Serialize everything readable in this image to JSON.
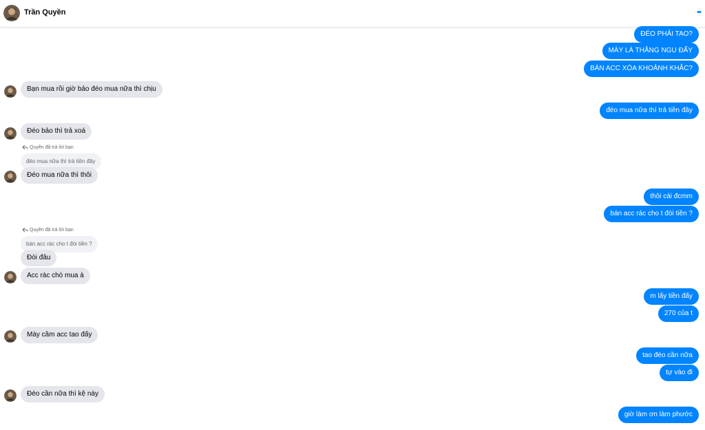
{
  "header": {
    "name": "Trần Quyền",
    "more_icon": "more-dots-icon"
  },
  "colors": {
    "outgoing_bubble": "#0084ff",
    "incoming_bubble": "#e4e6eb",
    "quote_bubble": "#f0f2f5",
    "secondary_text": "#65676b"
  },
  "messages": [
    {
      "from": "me",
      "text": "ĐÉO PHẢI TAO?"
    },
    {
      "from": "me",
      "text": "MÀY LÀ THẰNG NGU ĐẤY"
    },
    {
      "from": "me",
      "text": "BÁN ACC XÓA KHOẢNH KHẮC?"
    },
    {
      "from": "them",
      "text": "Bạn mua rồi giờ bảo đéo mua nữa thì chịu"
    },
    {
      "from": "me",
      "text": "đéo mua nữa thì trả tiền đây"
    },
    {
      "from": "them",
      "text": "Đéo bảo thì trả xoá"
    },
    {
      "from": "them",
      "reply_label": "Quyền đã trả lời bạn",
      "quoted": "đéo mua nữa thì trả tiền đây",
      "text": "Đéo mua nữa thì thôi"
    },
    {
      "from": "me",
      "text": "thôi cái đcmm"
    },
    {
      "from": "me",
      "text": "bán acc rác cho t đòi tiền ?"
    },
    {
      "from": "them",
      "reply_label": "Quyền đã trả lời bạn",
      "quoted": "bán acc rác cho t đòi tiền ?",
      "text": "Đòi đâu"
    },
    {
      "from": "them",
      "text": "Acc rác chó mua à"
    },
    {
      "from": "me",
      "text": "m lấy tiền đấy"
    },
    {
      "from": "me",
      "text": "270 của t"
    },
    {
      "from": "them",
      "text": "Mày cầm acc tao đấy"
    },
    {
      "from": "me",
      "text": "tao đéo cần nữa"
    },
    {
      "from": "me",
      "text": "tự vào đi"
    },
    {
      "from": "them",
      "text": "Đéo cần nữa thì kệ này"
    },
    {
      "from": "me",
      "text": "giờ làm ơn làm phước"
    }
  ]
}
